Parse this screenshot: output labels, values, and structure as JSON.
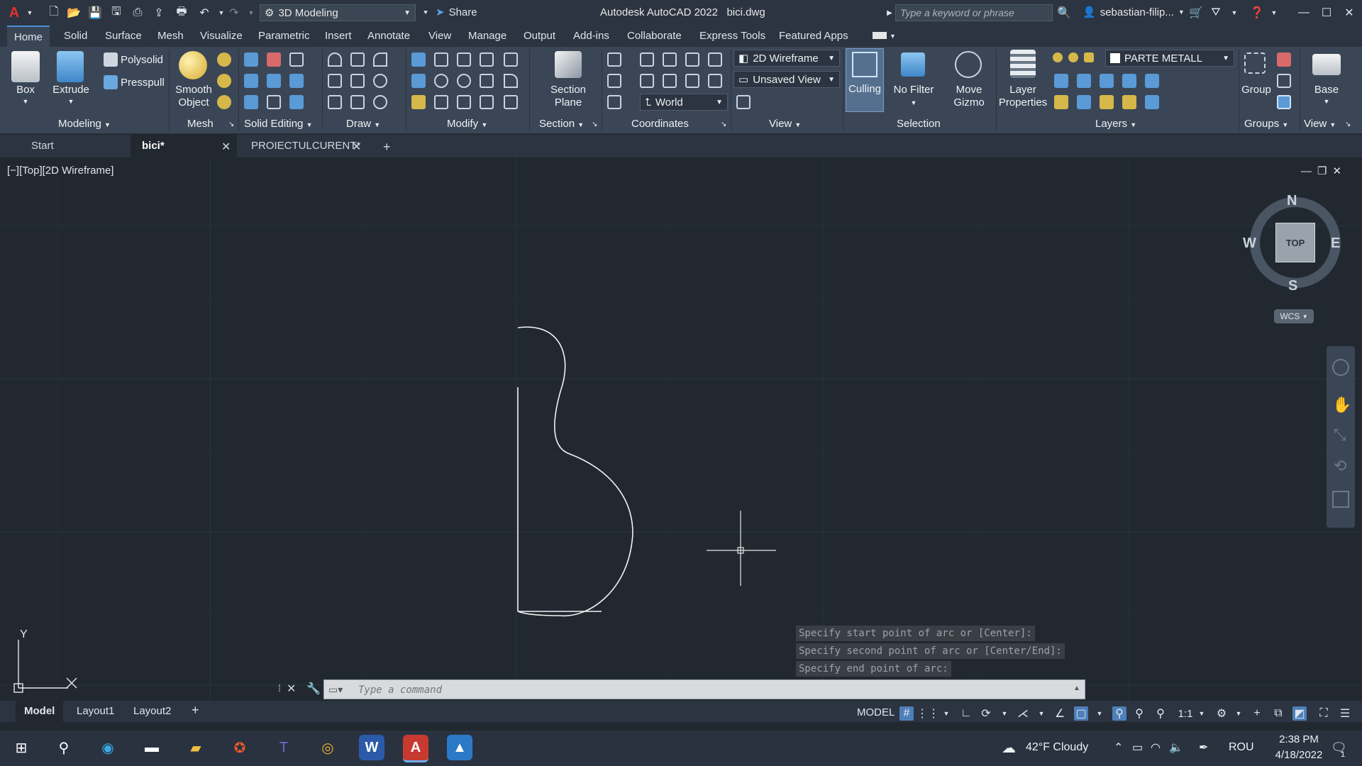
{
  "titlebar": {
    "workspace": "3D Modeling",
    "share": "Share",
    "app_title": "Autodesk AutoCAD 2022",
    "file": "bici.dwg",
    "search_placeholder": "Type a keyword or phrase",
    "user": "sebastian-filip..."
  },
  "menu_tabs": [
    "Home",
    "Solid",
    "Surface",
    "Mesh",
    "Visualize",
    "Parametric",
    "Insert",
    "Annotate",
    "View",
    "Manage",
    "Output",
    "Add-ins",
    "Collaborate",
    "Express Tools",
    "Featured Apps"
  ],
  "ribbon": {
    "box": "Box",
    "extrude": "Extrude",
    "polysolid": "Polysolid",
    "presspull": "Presspull",
    "smooth_object": "Smooth Object",
    "section_plane": "Section Plane",
    "visual_style": "2D Wireframe",
    "saved_view": "Unsaved View",
    "ucs": "World",
    "culling": "Culling",
    "no_filter": "No Filter",
    "move_gizmo": "Move Gizmo",
    "layer_properties": "Layer Properties",
    "current_layer": "PARTE METALL",
    "group": "Group",
    "base": "Base",
    "panels": {
      "modeling": "Modeling",
      "mesh": "Mesh",
      "solid_editing": "Solid Editing",
      "draw": "Draw",
      "modify": "Modify",
      "section": "Section",
      "coordinates": "Coordinates",
      "view": "View",
      "selection": "Selection",
      "layers": "Layers",
      "groups": "Groups",
      "view2": "View"
    }
  },
  "doc_tabs": [
    "Start",
    "bici*",
    "PROIECTULCURENT*"
  ],
  "viewport_label": "[−][Top][2D Wireframe]",
  "navcube": {
    "n": "N",
    "s": "S",
    "e": "E",
    "w": "W",
    "top": "TOP",
    "wcs": "WCS"
  },
  "ucs_icon": {
    "y": "Y"
  },
  "command_history": [
    "Specify start point of arc or [Center]:",
    "Specify second point of arc or [Center/End]:",
    "Specify end point of arc:"
  ],
  "command_placeholder": "Type a command",
  "layout_tabs": [
    "Model",
    "Layout1",
    "Layout2"
  ],
  "status": {
    "model": "MODEL",
    "scale": "1:1"
  },
  "taskbar": {
    "weather": "42°F  Cloudy",
    "lang": "ROU",
    "time": "2:38 PM",
    "date": "4/18/2022",
    "notifications": "1"
  },
  "colors": {
    "accent": "#4d8cd6",
    "canvas": "#212830",
    "ribbon": "#3a4656"
  }
}
